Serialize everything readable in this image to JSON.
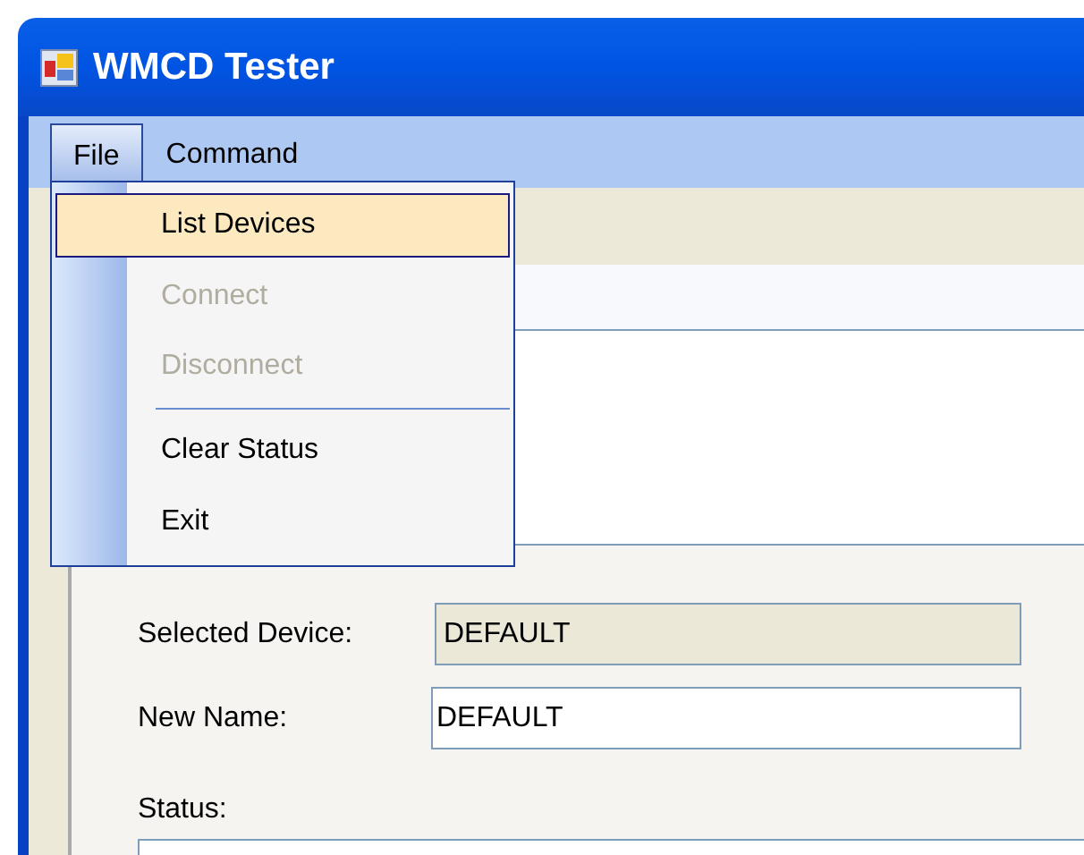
{
  "window": {
    "title": "WMCD Tester"
  },
  "menu_bar": [
    {
      "label": "File",
      "selected": true
    },
    {
      "label": "Command",
      "selected": false
    }
  ],
  "file_menu": [
    {
      "kind": "item",
      "label": "List Devices",
      "selected": true,
      "disabled": false
    },
    {
      "kind": "item",
      "label": "Connect",
      "selected": false,
      "disabled": true
    },
    {
      "kind": "item",
      "label": "Disconnect",
      "selected": false,
      "disabled": true
    },
    {
      "kind": "separator"
    },
    {
      "kind": "item",
      "label": "Clear Status",
      "selected": false,
      "disabled": false
    },
    {
      "kind": "item",
      "label": "Exit",
      "selected": false,
      "disabled": false
    }
  ],
  "form": {
    "fields": [
      {
        "label": "Selected Device:",
        "value": "DEFAULT",
        "disabled": true
      },
      {
        "label": "New Name:",
        "value": "DEFAULT",
        "disabled": false
      }
    ],
    "status": {
      "label": "Status:"
    }
  }
}
